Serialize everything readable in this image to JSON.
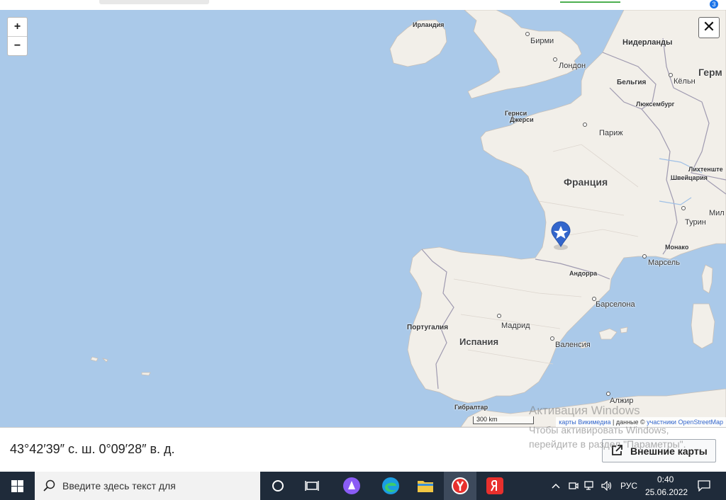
{
  "map": {
    "zoom_in": "+",
    "zoom_out": "−",
    "close": "✕",
    "labels": {
      "ireland": "Ирландия",
      "birmingham": "Бирми",
      "london": "Лондон",
      "netherlands": "Нидерланды",
      "germany": "Герм",
      "belgium": "Бельгия",
      "cologne": "Кёльн",
      "luxembourg": "Люксембург",
      "guernsey": "Гернси",
      "jersey": "Джерси",
      "paris": "Париж",
      "liechtenstein": "Лихтенште",
      "switzerland": "Швейцария",
      "france": "Франция",
      "milan": "Мил",
      "turin": "Турин",
      "monaco": "Монако",
      "marseille": "Марсель",
      "andorra": "Андорра",
      "portugal": "Португалия",
      "madrid": "Мадрид",
      "barcelona": "Барселона",
      "spain": "Испания",
      "valencia": "Валенсия",
      "algiers": "Алжир",
      "gibraltar": "Гибралтар"
    },
    "scale": "300 km",
    "attribution_prefix": "карты Викимедиа",
    "attribution_mid": " | данные © ",
    "attribution_link": "участники OpenStreetMap",
    "marker_icon": "star-marker-icon",
    "marker_color": "#3366cc"
  },
  "watermark": {
    "title": "Активация Windows",
    "line1": "Чтобы активировать Windows,",
    "line2": "перейдите в раздел \"Параметры\"."
  },
  "info": {
    "coordinates": "43°42′39″ с. ш. 0°09′28″ в. д.",
    "external_maps": "Внешние карты"
  },
  "taskbar": {
    "search_placeholder": "Введите здесь текст для",
    "language": "РУС",
    "time": "0:40",
    "date": "25.06.2022",
    "notification_badge": "3"
  }
}
